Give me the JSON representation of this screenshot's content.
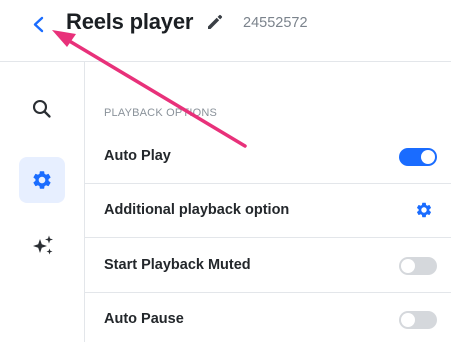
{
  "header": {
    "title": "Reels player",
    "player_id": "24552572"
  },
  "settings": {
    "section_label": "PLAYBACK OPTIONS",
    "options": [
      {
        "label": "Auto Play",
        "control": "toggle",
        "state": "on"
      },
      {
        "label": "Additional playback option",
        "control": "settings-gear"
      },
      {
        "label": "Start Playback Muted",
        "control": "toggle",
        "state": "off"
      },
      {
        "label": "Auto Pause",
        "control": "toggle",
        "state": "off"
      }
    ]
  },
  "sidebar": {
    "items": [
      {
        "icon": "search-icon",
        "active": false
      },
      {
        "icon": "gear-icon",
        "active": true
      },
      {
        "icon": "sparkles-icon",
        "active": false
      }
    ]
  },
  "colors": {
    "accent": "#1a6cff",
    "annotation_arrow": "#e8317a",
    "active_tab_bg": "#e7efff"
  }
}
